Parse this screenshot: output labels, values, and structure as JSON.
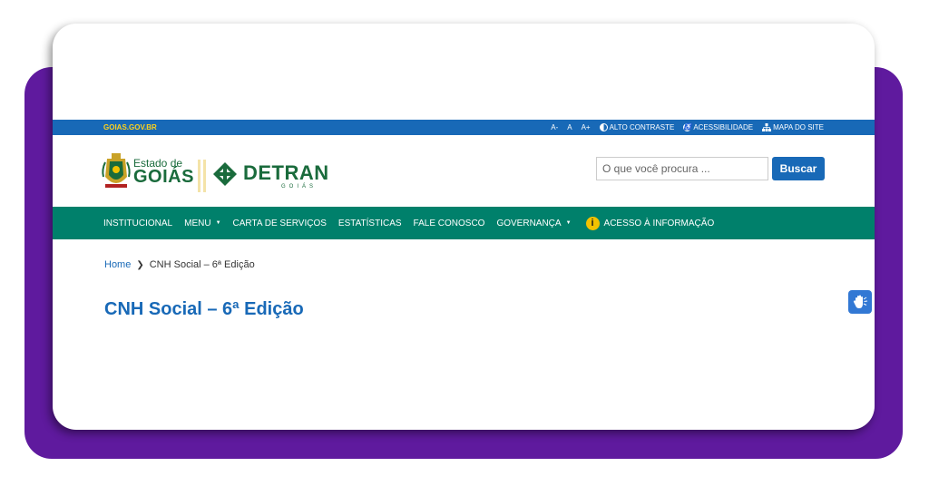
{
  "gov_bar": {
    "site_link": "GOIAS.GOV.BR",
    "font_decrease": "A-",
    "font_normal": "A",
    "font_increase": "A+",
    "high_contrast": "ALTO CONTRASTE",
    "accessibility": "ACESSIBILIDADE",
    "sitemap": "MAPA DO SITE"
  },
  "header": {
    "logo_goias_small": "Estado de",
    "logo_goias_big": "GOIÁS",
    "logo_detran": "DETRAN",
    "logo_detran_sub": "GOIÁS",
    "search_placeholder": "O que você procura ...",
    "search_button": "Buscar"
  },
  "nav": {
    "items": [
      {
        "label": "INSTITUCIONAL"
      },
      {
        "label": "MENU"
      },
      {
        "label": "CARTA DE SERVIÇOS"
      },
      {
        "label": "ESTATÍSTICAS"
      },
      {
        "label": "FALE CONOSCO"
      },
      {
        "label": "GOVERNANÇA"
      },
      {
        "label": "ACESSO À INFORMAÇÃO"
      }
    ]
  },
  "breadcrumb": {
    "home": "Home",
    "separator": "❯",
    "current": "CNH Social – 6ª Edição"
  },
  "page": {
    "title": "CNH Social – 6ª Edição"
  },
  "colors": {
    "purple_frame": "#5f1a9e",
    "gov_bar_blue": "#1869b7",
    "nav_green": "#00806b",
    "title_blue": "#1869b7",
    "logo_green": "#1a6b3c"
  },
  "icons": {
    "contrast": "contrast-icon",
    "accessibility": "accessibility-icon",
    "sitemap": "sitemap-icon",
    "info": "info-icon",
    "vlibras": "sign-language-hand-icon"
  }
}
